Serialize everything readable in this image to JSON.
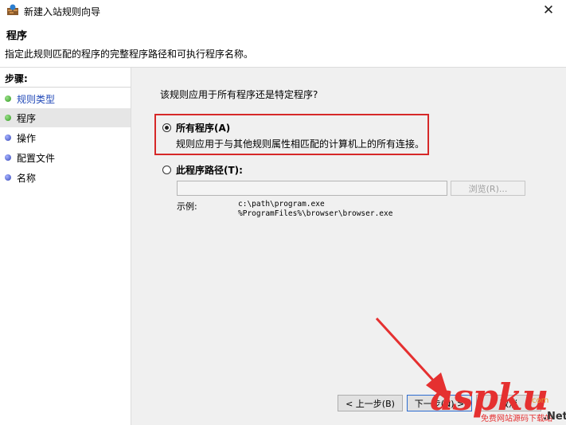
{
  "window": {
    "title": "新建入站规则向导",
    "close_glyph": "✕"
  },
  "header": {
    "title": "程序",
    "description": "指定此规则匹配的程序的完整程序路径和可执行程序名称。"
  },
  "steps": {
    "title": "步骤:",
    "items": [
      {
        "label": "规则类型",
        "state": "completed"
      },
      {
        "label": "程序",
        "state": "current"
      },
      {
        "label": "操作",
        "state": "pending"
      },
      {
        "label": "配置文件",
        "state": "pending"
      },
      {
        "label": "名称",
        "state": "pending"
      }
    ]
  },
  "main": {
    "question": "该规则应用于所有程序还是特定程序?",
    "option_all": {
      "label": "所有程序(A)",
      "description": "规则应用于与其他规则属性相匹配的计算机上的所有连接。",
      "checked": true
    },
    "option_path": {
      "label": "此程序路径(T):",
      "checked": false,
      "input_value": "",
      "browse_label": "浏览(R)...",
      "example_label": "示例:",
      "example_lines": [
        "c:\\path\\program.exe",
        "%ProgramFiles%\\browser\\browser.exe"
      ]
    }
  },
  "footer": {
    "back_label": "< 上一步(B)",
    "next_label": "下一步(N) >",
    "cancel_label": "取消"
  },
  "watermark": {
    "main": "aspku",
    "suffix": ".Net",
    "caption": "免费网站源码下载站",
    "small": "com"
  },
  "colors": {
    "highlight": "#d62828",
    "link": "#2149b8",
    "arrow": "#e53030"
  }
}
